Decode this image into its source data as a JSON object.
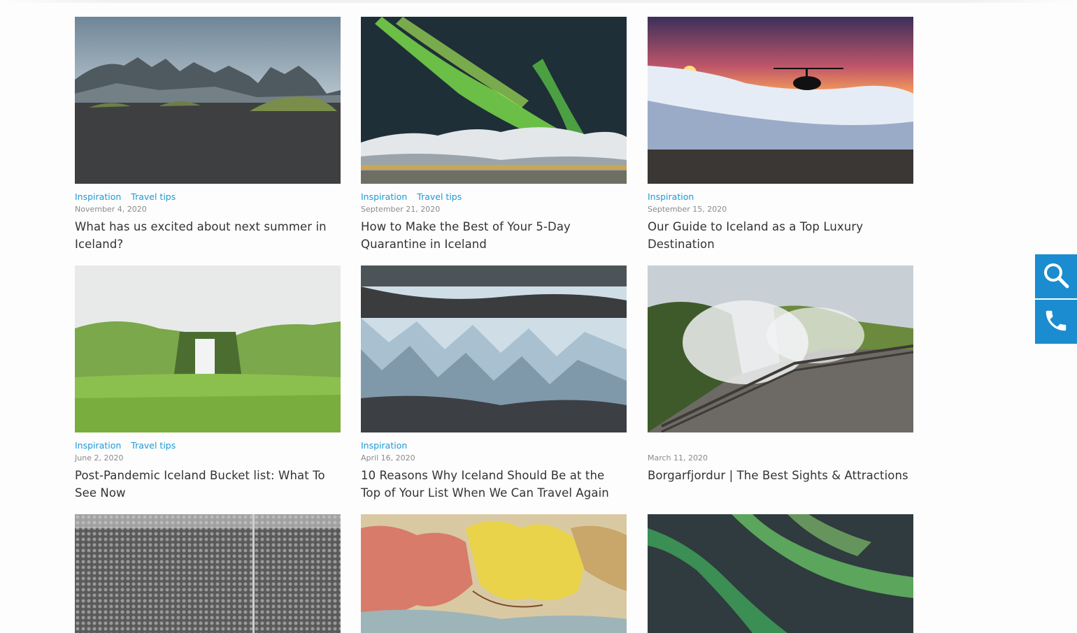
{
  "posts": [
    {
      "tags": [
        "Inspiration",
        "Travel tips"
      ],
      "date": "November 4, 2020",
      "title": "What has us excited about next summer in Iceland?"
    },
    {
      "tags": [
        "Inspiration",
        "Travel tips"
      ],
      "date": "September 21, 2020",
      "title": "How to Make the Best of Your 5-Day Quarantine in Iceland"
    },
    {
      "tags": [
        "Inspiration"
      ],
      "date": "September 15, 2020",
      "title": "Our Guide to Iceland as a Top Luxury Destination"
    },
    {
      "tags": [
        "Inspiration",
        "Travel tips"
      ],
      "date": "June 2, 2020",
      "title": "Post-Pandemic Iceland Bucket list: What To See Now"
    },
    {
      "tags": [
        "Inspiration"
      ],
      "date": "April 16, 2020",
      "title": "10 Reasons Why Iceland Should Be at the Top of Your List When We Can Travel Again"
    },
    {
      "tags": [],
      "date": "March 11, 2020",
      "title": "Borgarfjordur | The Best Sights & Attractions"
    },
    {
      "tags": [],
      "date": "",
      "title": ""
    },
    {
      "tags": [],
      "date": "",
      "title": ""
    },
    {
      "tags": [],
      "date": "",
      "title": ""
    }
  ],
  "images": [
    "black-sand-beach-mountains",
    "northern-lights-over-village",
    "helicopter-at-sunset",
    "skogafoss-waterfall",
    "glacier-ice-field",
    "geothermal-steam-boardwalk",
    "crowd-black-and-white",
    "antique-map-of-iceland",
    "aurora-night-sky"
  ],
  "side_buttons": {
    "search": "search-icon",
    "phone": "phone-icon"
  },
  "colors": {
    "accent": "#1a9ad6",
    "button": "#1a8ccf",
    "title": "#333333",
    "date": "#8a8a8a"
  }
}
